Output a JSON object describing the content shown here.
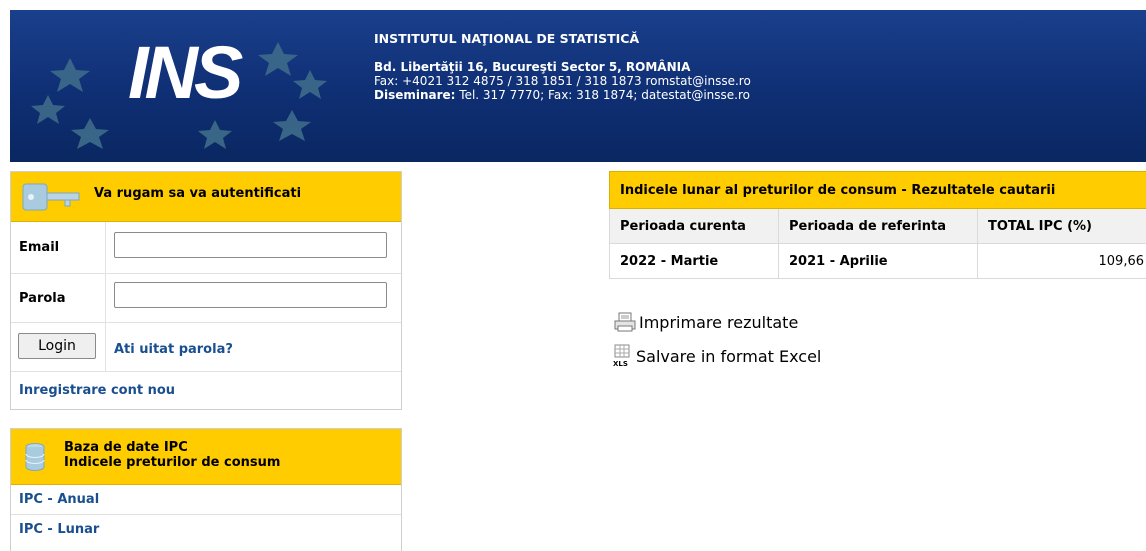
{
  "header": {
    "logo_text": "INS",
    "org_name": "INSTITUTUL NAŢIONAL DE STATISTICĂ",
    "address": "Bd. Libertăţii 16, Bucureşti Sector 5, ROMÂNIA",
    "fax_line": "Fax: +4021 312 4875 / 318 1851 / 318 1873 romstat@insse.ro",
    "diseminare_label": "Diseminare:",
    "diseminare_value": " Tel.  317 7770; Fax: 318 1874; datestat@insse.ro"
  },
  "login": {
    "title": "Va rugam sa va autentificati",
    "email_label": "Email",
    "email_value": "",
    "password_label": "Parola",
    "password_value": "",
    "login_button": "Login",
    "forgot_link": "Ati uitat parola?",
    "register_link": "Inregistrare cont nou",
    "icon": "key-icon"
  },
  "database": {
    "title_line1": "Baza de date IPC",
    "title_line2": "Indicele preturilor de consum",
    "icon": "database-icon",
    "items": [
      {
        "label": "IPC - Anual"
      },
      {
        "label": "IPC - Lunar"
      }
    ]
  },
  "results": {
    "title": "Indicele lunar al preturilor de consum - Rezultatele cautarii",
    "columns": [
      "Perioada curenta",
      "Perioada de referinta",
      "TOTAL IPC (%)"
    ],
    "rows": [
      [
        "2022 - Martie",
        "2021 - Aprilie",
        "109,66"
      ]
    ]
  },
  "actions": {
    "print_label": "Imprimare rezultate",
    "excel_label": "Salvare in format Excel",
    "print_icon": "printer-icon",
    "excel_icon": "xls-icon"
  },
  "colors": {
    "header_bg": "#1a3f8c",
    "panel_accent": "#ffcc00",
    "link": "#1a4f8f"
  }
}
